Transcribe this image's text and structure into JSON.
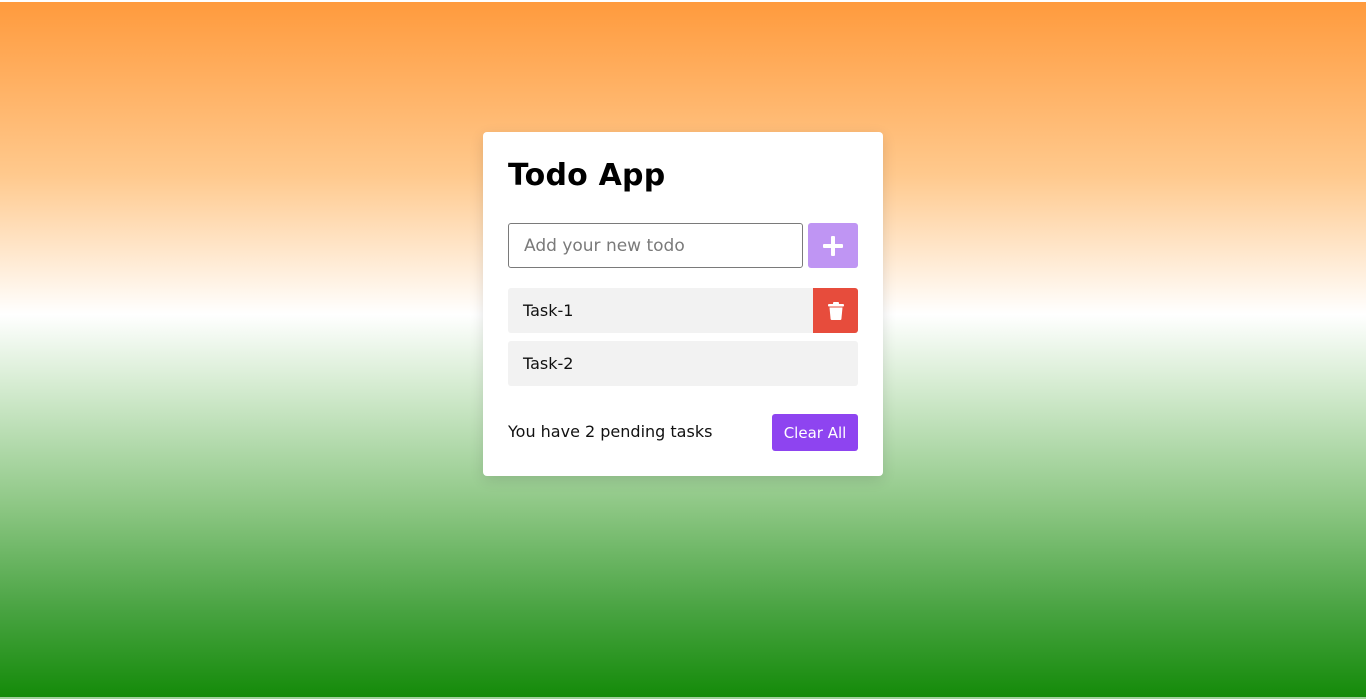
{
  "app": {
    "title": "Todo App"
  },
  "input": {
    "placeholder": "Add your new todo",
    "value": ""
  },
  "add_button": {
    "icon": "plus-icon"
  },
  "todos": [
    {
      "label": "Task-1",
      "delete_icon": "trash-icon"
    },
    {
      "label": "Task-2"
    }
  ],
  "footer": {
    "pending_text": "You have 2 pending tasks",
    "clear_label": "Clear All"
  },
  "colors": {
    "add_button": "#bf95f3",
    "delete_button": "#e74c3c",
    "clear_button": "#8e44f0",
    "item_background": "#f2f2f2",
    "gradient_top": "#ff9a3c",
    "gradient_middle": "#ffffff",
    "gradient_bottom": "#138a08"
  }
}
